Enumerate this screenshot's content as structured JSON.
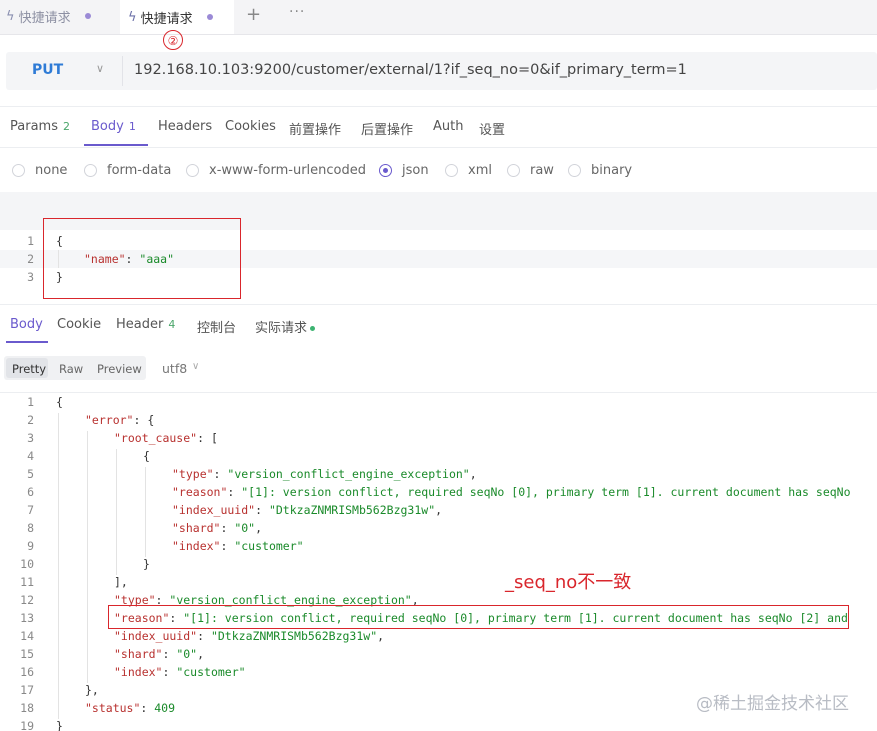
{
  "tabs": [
    {
      "label": "快捷请求"
    },
    {
      "label": "快捷请求"
    }
  ],
  "tab_actions": {
    "add": "+",
    "more": "···"
  },
  "annotation_marker": "②",
  "request": {
    "method": "PUT",
    "url": "192.168.10.103:9200/customer/external/1?if_seq_no=0&if_primary_term=1"
  },
  "request_tabs": [
    {
      "label": "Params",
      "count": "2"
    },
    {
      "label": "Body",
      "count": "1"
    },
    {
      "label": "Headers"
    },
    {
      "label": "Cookies"
    },
    {
      "label": "前置操作"
    },
    {
      "label": "后置操作"
    },
    {
      "label": "Auth"
    },
    {
      "label": "设置"
    }
  ],
  "body_types": [
    "none",
    "form-data",
    "x-www-form-urlencoded",
    "json",
    "xml",
    "raw",
    "binary"
  ],
  "selected_body_type": "json",
  "request_body_lines": [
    {
      "n": "1",
      "text": "{"
    },
    {
      "n": "2",
      "key": "\"name\"",
      "value": "\"aaa\""
    },
    {
      "n": "3",
      "text": "}"
    }
  ],
  "response_tabs": [
    {
      "label": "Body"
    },
    {
      "label": "Cookie"
    },
    {
      "label": "Header",
      "count": "4"
    },
    {
      "label": "控制台"
    },
    {
      "label": "实际请求"
    }
  ],
  "format_buttons": [
    "Pretty",
    "Raw",
    "Preview"
  ],
  "encoding": "utf8",
  "response_lines": [
    {
      "n": "1",
      "indent": 0,
      "pre": "{"
    },
    {
      "n": "2",
      "indent": 1,
      "key": "\"error\"",
      "post": ": {"
    },
    {
      "n": "3",
      "indent": 2,
      "key": "\"root_cause\"",
      "post": ": ["
    },
    {
      "n": "4",
      "indent": 3,
      "pre": "{"
    },
    {
      "n": "5",
      "indent": 4,
      "key": "\"type\"",
      "mid": ": ",
      "str": "\"version_conflict_engine_exception\"",
      "post": ","
    },
    {
      "n": "6",
      "indent": 4,
      "key": "\"reason\"",
      "mid": ": ",
      "str": "\"[1]: version conflict, required seqNo [0], primary term [1]. current document has seqNo"
    },
    {
      "n": "7",
      "indent": 4,
      "key": "\"index_uuid\"",
      "mid": ": ",
      "str": "\"DtkzaZNMRISMb562Bzg31w\"",
      "post": ","
    },
    {
      "n": "8",
      "indent": 4,
      "key": "\"shard\"",
      "mid": ": ",
      "str": "\"0\"",
      "post": ","
    },
    {
      "n": "9",
      "indent": 4,
      "key": "\"index\"",
      "mid": ": ",
      "str": "\"customer\""
    },
    {
      "n": "10",
      "indent": 3,
      "pre": "}"
    },
    {
      "n": "11",
      "indent": 2,
      "pre": "],"
    },
    {
      "n": "12",
      "indent": 2,
      "key": "\"type\"",
      "mid": ": ",
      "str": "\"version_conflict_engine_exception\"",
      "post": ","
    },
    {
      "n": "13",
      "indent": 2,
      "key": "\"reason\"",
      "mid": ": ",
      "str": "\"[1]: version conflict, required seqNo [0], primary term [1]. current document has seqNo [2] and"
    },
    {
      "n": "14",
      "indent": 2,
      "key": "\"index_uuid\"",
      "mid": ": ",
      "str": "\"DtkzaZNMRISMb562Bzg31w\"",
      "post": ","
    },
    {
      "n": "15",
      "indent": 2,
      "key": "\"shard\"",
      "mid": ": ",
      "str": "\"0\"",
      "post": ","
    },
    {
      "n": "16",
      "indent": 2,
      "key": "\"index\"",
      "mid": ": ",
      "str": "\"customer\""
    },
    {
      "n": "17",
      "indent": 1,
      "pre": "},"
    },
    {
      "n": "18",
      "indent": 1,
      "key": "\"status\"",
      "mid": ": ",
      "num": "409"
    },
    {
      "n": "19",
      "indent": 0,
      "pre": "}"
    }
  ],
  "annotation_text": "_seq_no不一致",
  "watermark": "@稀土掘金技术社区",
  "colors": {
    "accent": "#6a5acd",
    "method": "#2e7bd6",
    "highlight": "#d9262c",
    "json_key": "#b8312f",
    "json_string": "#1a8a2a"
  }
}
